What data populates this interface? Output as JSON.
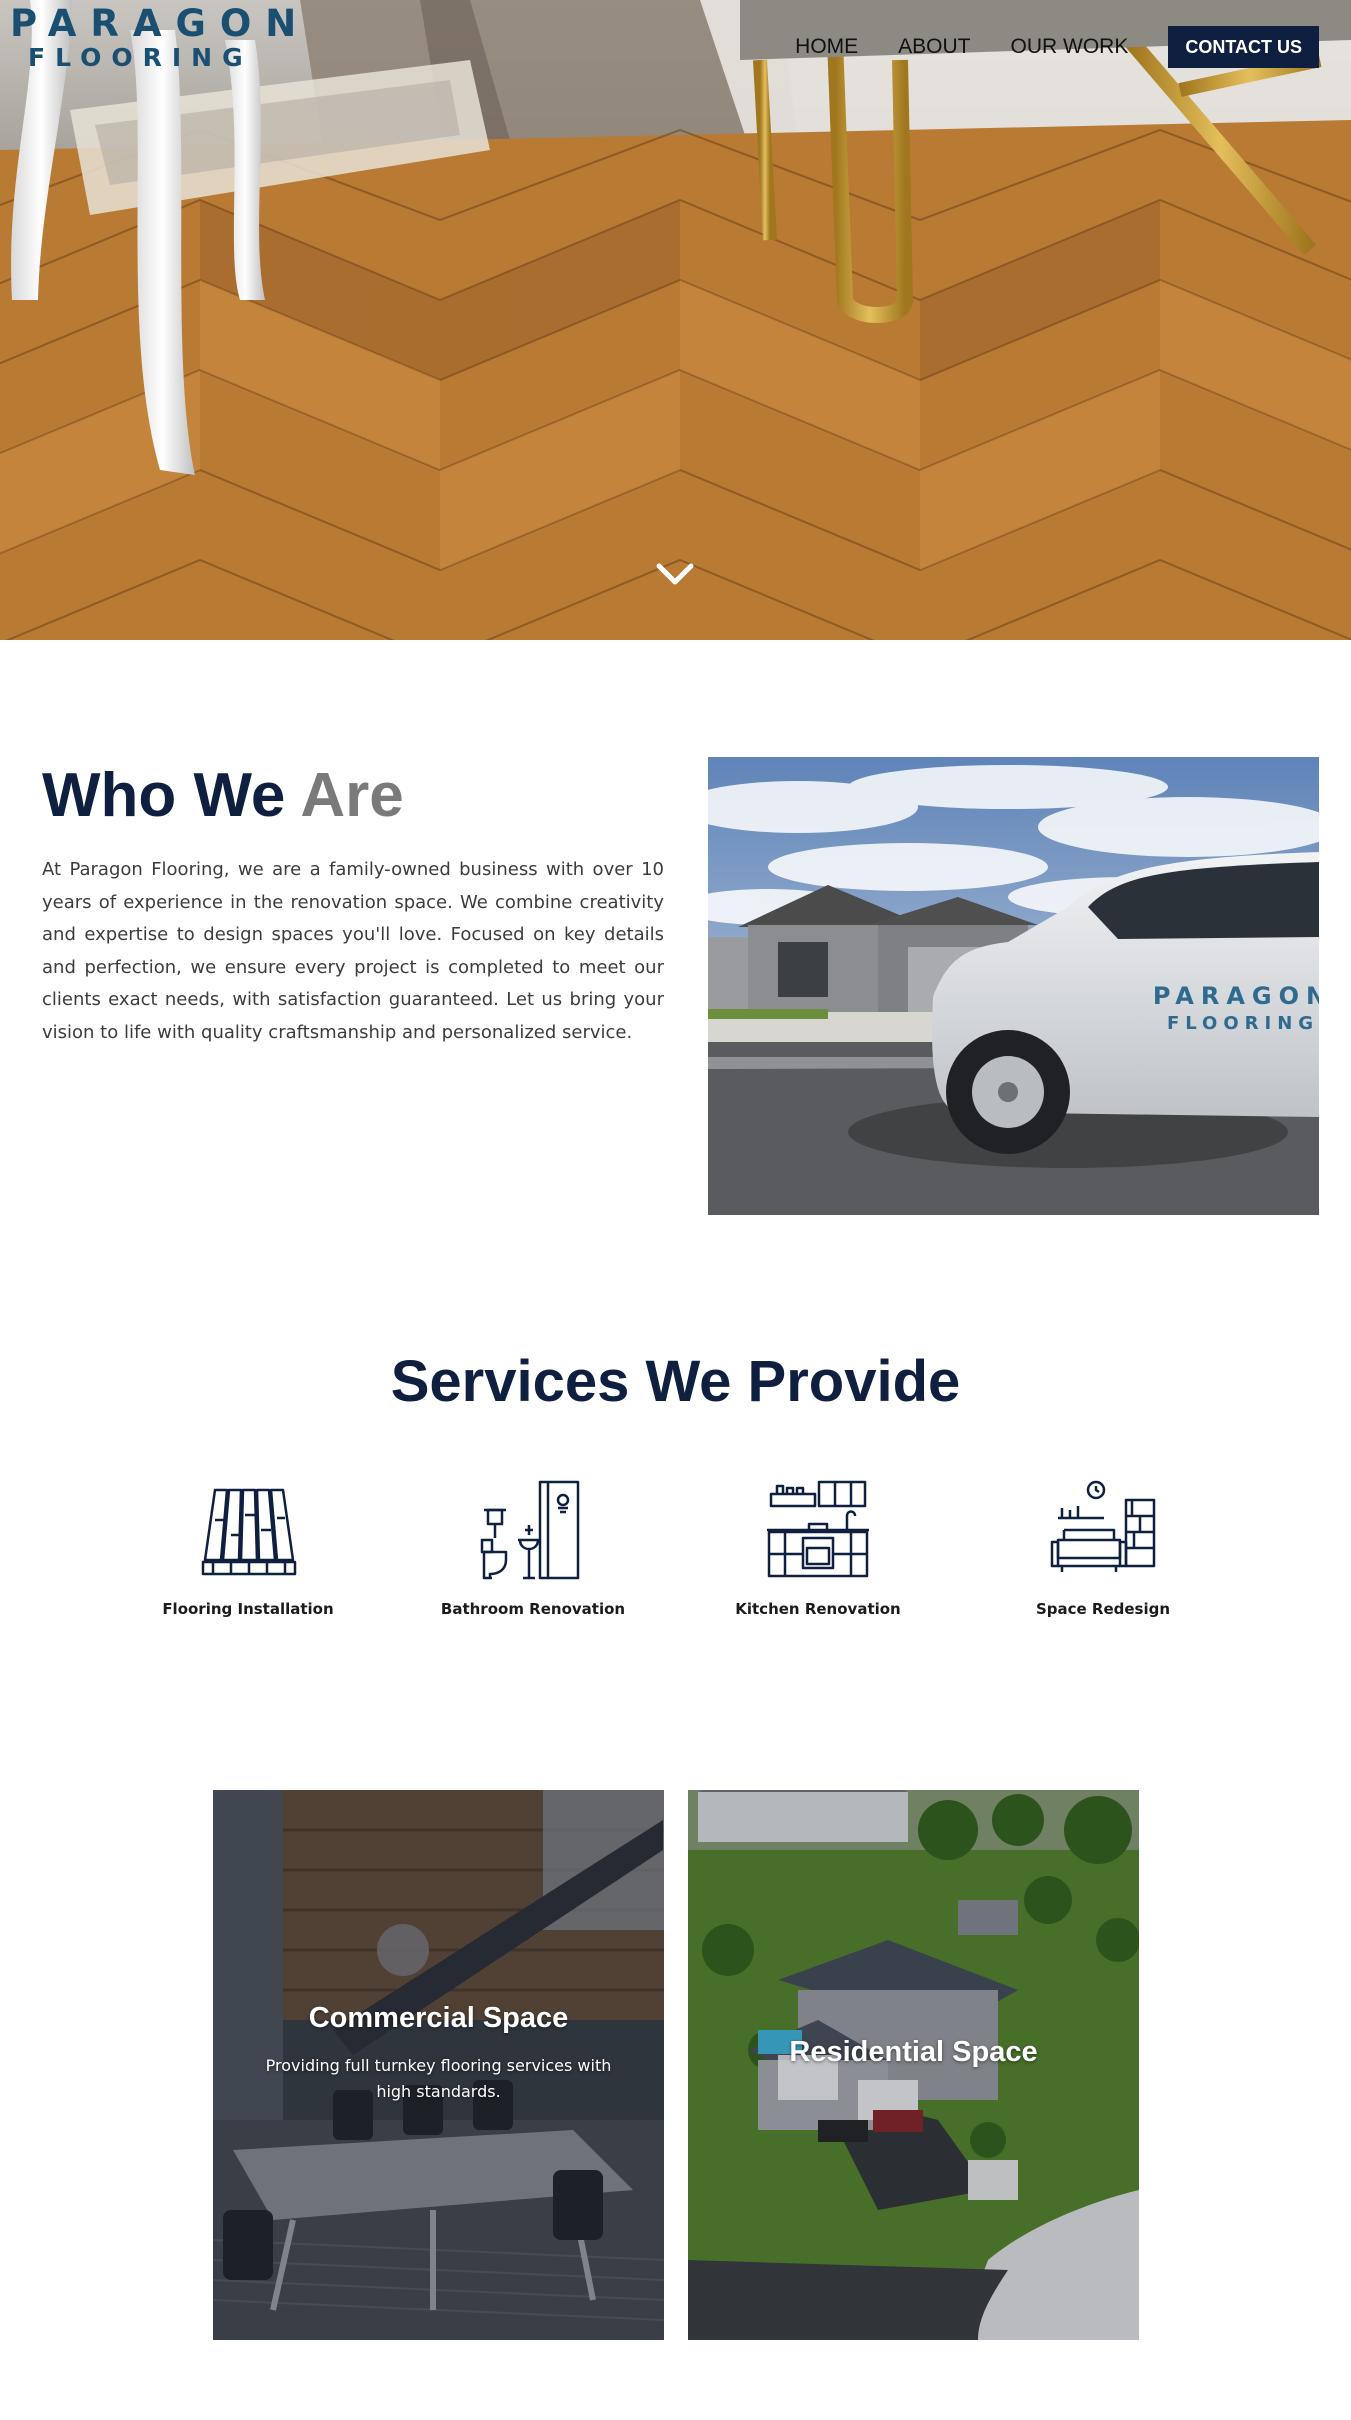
{
  "brand": {
    "logo_top": "PARAGON",
    "logo_bottom": "FLOORING",
    "color": "#1a4f72"
  },
  "nav": {
    "items": [
      {
        "label": "HOME"
      },
      {
        "label": "ABOUT"
      },
      {
        "label": "OUR WORK"
      }
    ],
    "contact_label": "CONTACT US",
    "contact_bg": "#0e1f3f"
  },
  "hero": {
    "scroll_icon": "chevron-down-icon"
  },
  "who": {
    "title_part1": "Who We",
    "title_part2": "Are",
    "body": "At Paragon Flooring, we are a family-owned business with over 10 years of experience in the renovation space. We combine creativity and expertise to design spaces you'll love. Focused on key details and perfection, we ensure every project is completed to meet our clients exact needs, with satisfaction guaranteed. Let us bring your vision to life with quality craftsmanship and personalized service.",
    "truck_logo_top": "PARAGON",
    "truck_logo_bottom": "FLOORING"
  },
  "services": {
    "title": "Services We Provide",
    "items": [
      {
        "label": "Flooring Installation",
        "icon": "flooring-planks-icon"
      },
      {
        "label": "Bathroom Renovation",
        "icon": "bathroom-icon"
      },
      {
        "label": "Kitchen Renovation",
        "icon": "kitchen-icon"
      },
      {
        "label": "Space Redesign",
        "icon": "living-room-icon"
      }
    ]
  },
  "cards": [
    {
      "title": "Commercial Space",
      "description": "Providing full turnkey flooring services with high standards."
    },
    {
      "title": "Residential Space"
    }
  ],
  "colors": {
    "navy": "#0e1f3f",
    "gray_title": "#7a7a7a",
    "text": "#3c3c3c"
  }
}
